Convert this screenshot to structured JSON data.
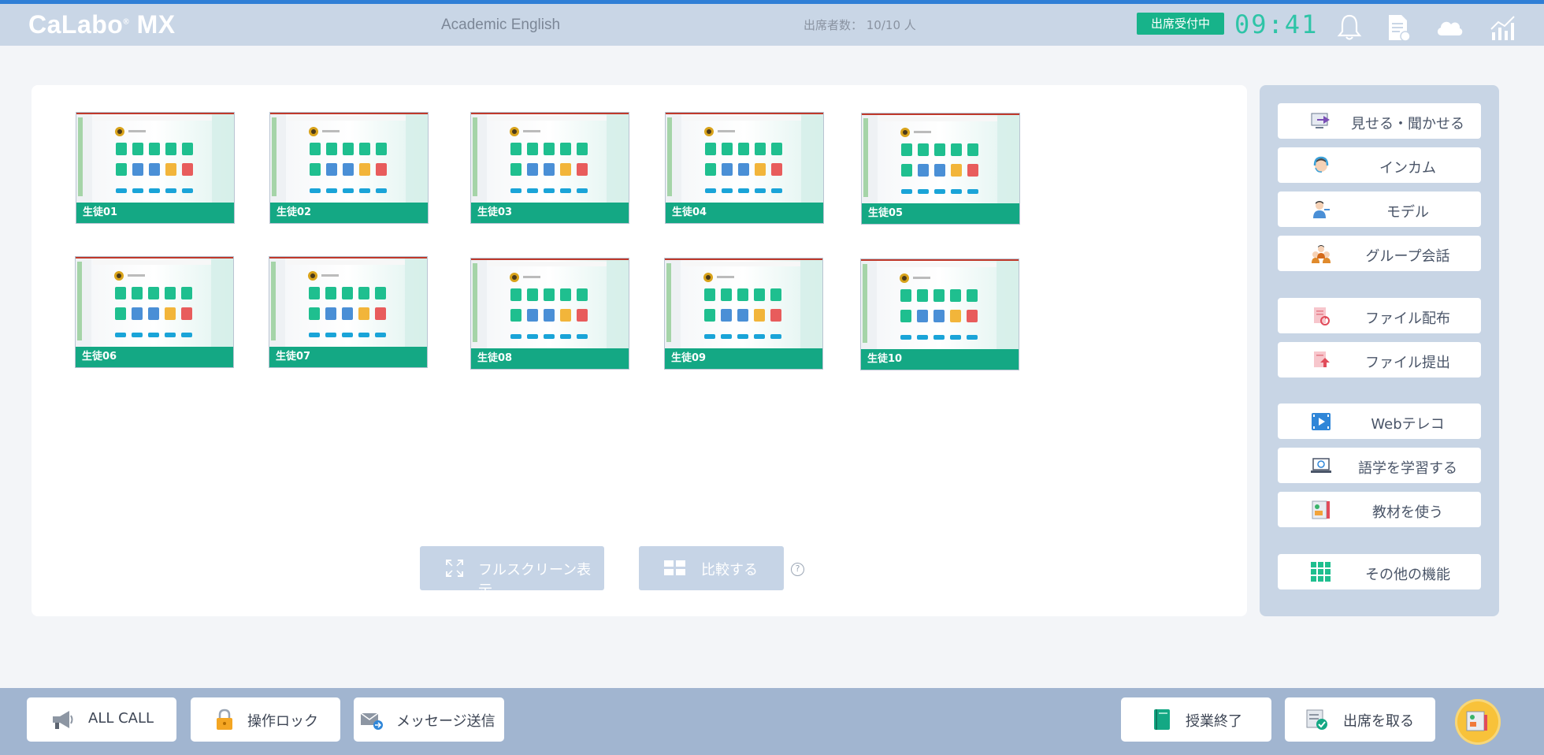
{
  "header": {
    "logo": "CaLabo",
    "logo_reg": "®",
    "logo_suffix": " MX",
    "course": "Academic English",
    "attendance": "出席者数： 10/10 人",
    "status_badge": "出席受付中",
    "clock": "09:41",
    "icons": [
      "bell-icon",
      "document-icon",
      "cloud-icon",
      "chart-icon"
    ]
  },
  "students": [
    {
      "label": "生徒01"
    },
    {
      "label": "生徒02"
    },
    {
      "label": "生徒03"
    },
    {
      "label": "生徒04"
    },
    {
      "label": "生徒05"
    },
    {
      "label": "生徒06"
    },
    {
      "label": "生徒07"
    },
    {
      "label": "生徒08"
    },
    {
      "label": "生徒09"
    },
    {
      "label": "生徒10"
    }
  ],
  "actions": {
    "fullscreen": "フルスクリーン表示",
    "compare": "比較する",
    "help": "?"
  },
  "side": {
    "show_listen": "見せる・聞かせる",
    "intercom": "インカム",
    "model": "モデル",
    "group_talk": "グループ会話",
    "file_distribute": "ファイル配布",
    "file_submit": "ファイル提出",
    "web_recorder": "Webテレコ",
    "learn_language": "語学を学習する",
    "use_materials": "教材を使う",
    "other_functions": "その他の機能"
  },
  "footer": {
    "all_call": "ALL CALL",
    "lock": "操作ロック",
    "message": "メッセージ送信",
    "end_class": "授業終了",
    "take_attendance": "出席を取る"
  },
  "colors": {
    "accent_green": "#14a884",
    "header_bg": "#c9d6e6",
    "footer_bg": "#a1b5d0",
    "top_line": "#2f7fd6"
  }
}
